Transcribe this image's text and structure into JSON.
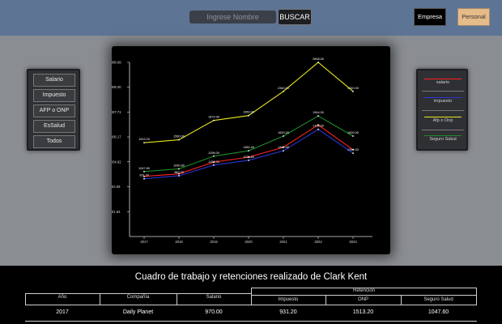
{
  "header": {
    "search_placeholder": "Ingrese Nombre",
    "search_button": "BUSCAR",
    "empresa_button": "Empresa",
    "personal_button": "Personal"
  },
  "filters": [
    "Salario",
    "Impuesto",
    "AFP o ONP",
    "EsSalud",
    "Todos"
  ],
  "legend": [
    {
      "label": "salario",
      "color": "#ff2020"
    },
    {
      "label": "impuesto",
      "color": "#2a35d8"
    },
    {
      "label": "Afp o Onp",
      "color": "#e6e61e"
    },
    {
      "label": "Seguro Salud",
      "color": "#1e8a2a"
    }
  ],
  "chart_data": {
    "type": "line",
    "x": [
      "2017",
      "2018",
      "2019",
      "2020",
      "2021",
      "2022",
      "2023"
    ],
    "y_ticks": [
      "2808.08",
      "2408.30",
      "2007.71",
      "1606.17",
      "1204.62",
      "803.08",
      "401.54"
    ],
    "ylim": [
      0,
      2808.08
    ],
    "grid": false,
    "series": [
      {
        "name": "salario",
        "color": "#ff2020",
        "values": [
          970,
          1010,
          1200,
          1280,
          1440,
          1800,
          1400
        ]
      },
      {
        "name": "impuesto",
        "color": "#2a35d8",
        "values": [
          931.2,
          980,
          1152,
          1228.8,
          1382.4,
          1728,
          1344
        ],
        "labels": [
          "931.20",
          "980.00",
          "1152.00",
          "1228.80",
          "1382.40",
          "1728.00",
          "1344.00"
        ]
      },
      {
        "name": "Afp o Onp",
        "color": "#e6e61e",
        "values": [
          1513.2,
          1560,
          1872,
          1950,
          2340,
          2808,
          2340
        ],
        "labels": [
          "1513.20",
          "1560.00",
          "1872.00",
          "1950.00",
          "2340.00",
          "2808.00",
          "2340.00"
        ]
      },
      {
        "name": "Seguro Salud",
        "color": "#1e8a2a",
        "values": [
          1047.6,
          1090.8,
          1296,
          1382.4,
          1620,
          1944,
          1620
        ],
        "labels": [
          "1047.60",
          "1090.80",
          "1296.00",
          "1382.40",
          "1620.00",
          "1944.00",
          "1620.00"
        ]
      }
    ]
  },
  "table": {
    "title": "Cuadro de trabajo y retenciones realizado de Clark Kent",
    "group_header": "Retencion",
    "columns": [
      "Año",
      "Compañía",
      "Salario",
      "Impuesto",
      "ONP",
      "Seguro Salud"
    ],
    "rows": [
      [
        "2017",
        "Daily Planet",
        "970.00",
        "931.20",
        "1513.20",
        "1047.60"
      ]
    ]
  }
}
